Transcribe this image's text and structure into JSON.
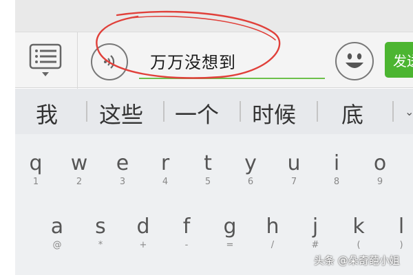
{
  "input": {
    "value": "万万没想到"
  },
  "send": {
    "label": "发送"
  },
  "candidates": [
    "我",
    "这些",
    "一个",
    "时候",
    "底"
  ],
  "candidate_more_icon": "chevron-down-icon",
  "keyboard": {
    "row1": [
      {
        "key": "q",
        "sub": "1"
      },
      {
        "key": "w",
        "sub": "2"
      },
      {
        "key": "e",
        "sub": "3"
      },
      {
        "key": "r",
        "sub": "4"
      },
      {
        "key": "t",
        "sub": "5"
      },
      {
        "key": "y",
        "sub": "6"
      },
      {
        "key": "u",
        "sub": "7"
      },
      {
        "key": "i",
        "sub": "8"
      },
      {
        "key": "o",
        "sub": "9"
      }
    ],
    "row2": [
      {
        "key": "a",
        "sub": "@"
      },
      {
        "key": "s",
        "sub": "*"
      },
      {
        "key": "d",
        "sub": "+"
      },
      {
        "key": "f",
        "sub": "-"
      },
      {
        "key": "g",
        "sub": "="
      },
      {
        "key": "h",
        "sub": "/"
      },
      {
        "key": "j",
        "sub": "#"
      },
      {
        "key": "k",
        "sub": "("
      },
      {
        "key": "l",
        "sub": ")"
      }
    ]
  },
  "watermark": "头条 @朵奇葩小姐",
  "colors": {
    "send_bg": "#4cb531",
    "underline": "#6cc04a",
    "annotation": "#e0403a"
  }
}
